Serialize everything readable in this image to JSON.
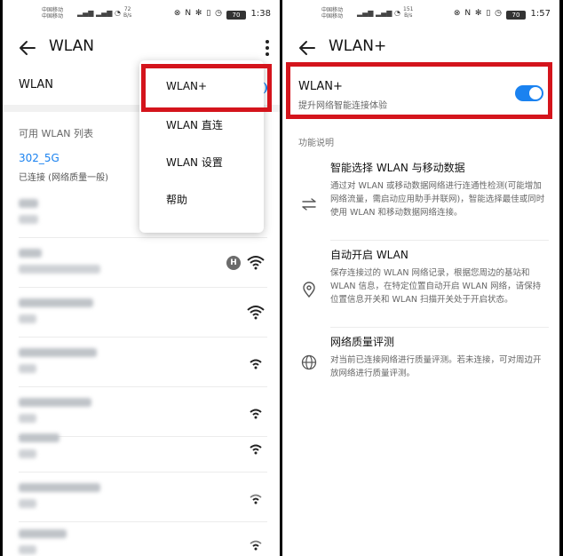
{
  "left": {
    "status": {
      "carrier1": "中国移动",
      "carrier2": "中国移动",
      "speed_value": "72",
      "speed_unit": "B/s",
      "battery": "70",
      "time": "1:38"
    },
    "title": "WLAN",
    "wlan_label": "WLAN",
    "available_label": "可用 WLAN 列表",
    "current_network": {
      "name": "302_5G",
      "status": "已连接 (网络质量一般)"
    },
    "menu": [
      "WLAN+",
      "WLAN 直连",
      "WLAN 设置",
      "帮助"
    ],
    "hotspot_badge": "H"
  },
  "right": {
    "status": {
      "carrier1": "中国移动",
      "carrier2": "中国移动",
      "speed_value": "151",
      "speed_unit": "B/s",
      "battery": "70",
      "time": "1:57"
    },
    "title": "WLAN+",
    "wlan_plus": {
      "title": "WLAN+",
      "subtitle": "提升网络智能连接体验",
      "enabled": true
    },
    "section_label": "功能说明",
    "features": [
      {
        "title": "智能选择 WLAN 与移动数据",
        "desc": "通过对 WLAN 或移动数据网络进行连通性检测(可能增加网络流量，需启动应用助手并联网)，智能选择最佳或同时使用 WLAN 和移动数据网络连接。",
        "icon": "swap-arrows-icon"
      },
      {
        "title": "自动开启 WLAN",
        "desc": "保存连接过的 WLAN 网络记录，根据您周边的基站和 WLAN 信息，在特定位置自动开启 WLAN 网络，请保持位置信息开关和 WLAN 扫描开关处于开启状态。",
        "icon": "location-pin-icon"
      },
      {
        "title": "网络质量评测",
        "desc": "对当前已连接网络进行质量评测。若未连接，可对周边开放网络进行质量评测。",
        "icon": "globe-icon"
      }
    ]
  },
  "colors": {
    "accent": "#1a82f0",
    "highlight": "#d4141c"
  }
}
